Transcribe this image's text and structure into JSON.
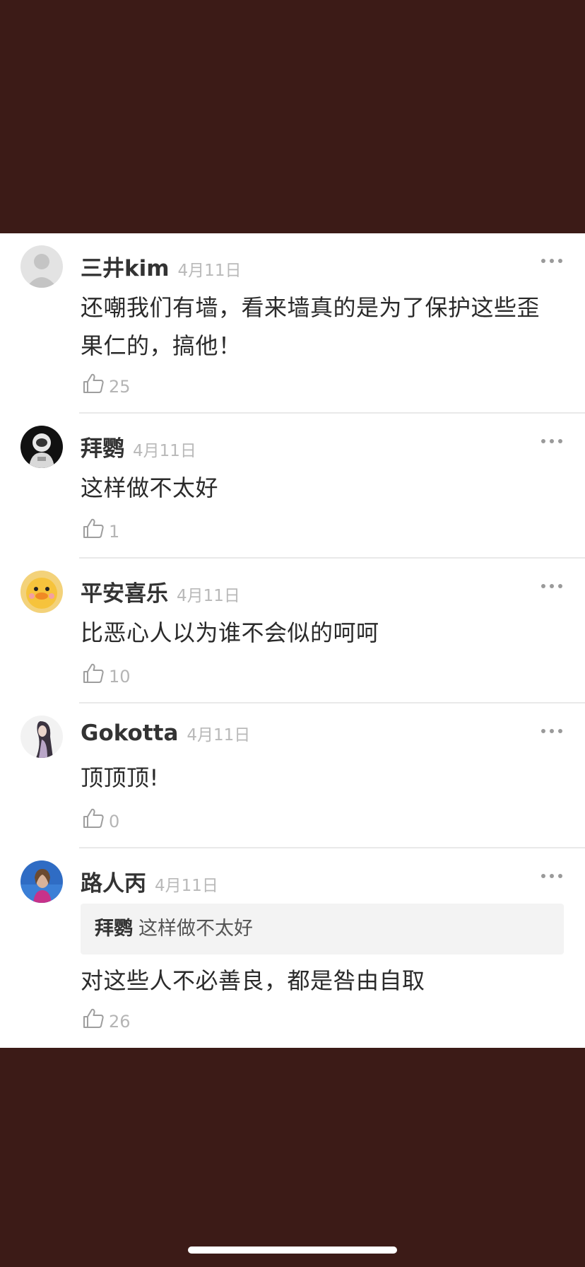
{
  "comments": [
    {
      "name": "三井kim",
      "date": "4月11日",
      "text": "还嘲我们有墙，看来墙真的是为了保护这些歪果仁的，搞他！",
      "likes": "25"
    },
    {
      "name": "拜鹦",
      "date": "4月11日",
      "text": "这样做不太好",
      "likes": "1"
    },
    {
      "name": "平安喜乐",
      "date": "4月11日",
      "text": "比恶心人以为谁不会似的呵呵",
      "likes": "10"
    },
    {
      "name": "Gokotta",
      "date": "4月11日",
      "text": "顶顶顶!",
      "likes": "0"
    },
    {
      "name": "路人丙",
      "date": "4月11日",
      "quote": {
        "name": "拜鹦",
        "text": "这样做不太好"
      },
      "text": "对这些人不必善良，都是咎由自取",
      "likes": "26"
    }
  ],
  "icons": {
    "like": "thumbs-up-outline-icon",
    "more": "more-dots-icon"
  },
  "colors": {
    "background": "#3c1b17",
    "card": "#ffffff",
    "name": "#333333",
    "meta": "#b9b9b9"
  }
}
